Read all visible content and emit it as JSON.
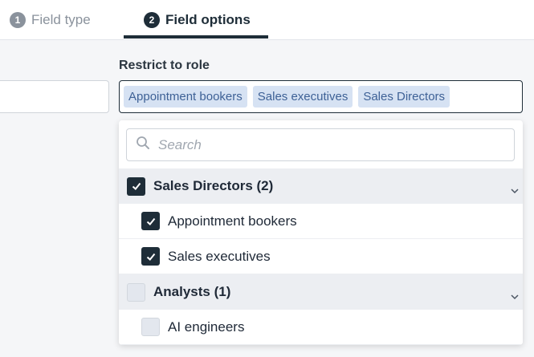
{
  "tabs": [
    {
      "number": "1",
      "label": "Field type",
      "active": false
    },
    {
      "number": "2",
      "label": "Field options",
      "active": true
    }
  ],
  "restrict": {
    "label": "Restrict to role",
    "chips": [
      "Appointment bookers",
      "Sales executives",
      "Sales Directors"
    ]
  },
  "dropdown": {
    "search_placeholder": "Search",
    "search_value": "",
    "rows": [
      {
        "label": "Sales Directors (2)",
        "kind": "group",
        "checked": true
      },
      {
        "label": "Appointment bookers",
        "kind": "child",
        "checked": true
      },
      {
        "label": "Sales executives",
        "kind": "child",
        "checked": true
      },
      {
        "label": "Analysts (1)",
        "kind": "group",
        "checked": false
      },
      {
        "label": "AI engineers",
        "kind": "child",
        "checked": false
      }
    ]
  },
  "colors": {
    "primary": "#1e2d38",
    "chip_bg": "#d6e2f3",
    "chip_text": "#3e6196",
    "muted": "#8a929c"
  },
  "icons": {
    "search": "search-icon",
    "check": "checkmark-icon",
    "expand": "chevron-down-icon"
  }
}
